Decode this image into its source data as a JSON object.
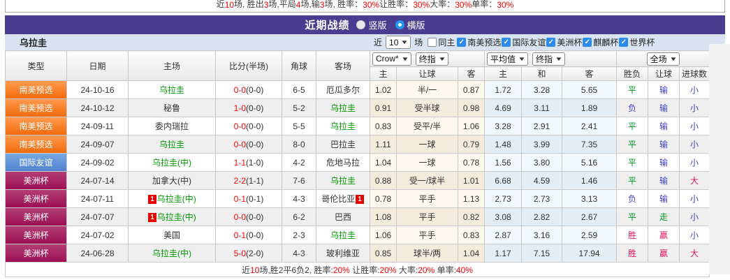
{
  "top_stats": {
    "segments": [
      {
        "t": "近 ",
        "c": "dark"
      },
      {
        "t": "10",
        "c": "red"
      },
      {
        "t": " 场, 胜出 ",
        "c": "dark"
      },
      {
        "t": "3",
        "c": "red"
      },
      {
        "t": " 场,平局 ",
        "c": "dark"
      },
      {
        "t": "4",
        "c": "red"
      },
      {
        "t": " 场,输 ",
        "c": "dark"
      },
      {
        "t": "3",
        "c": "red"
      },
      {
        "t": " 场, 胜率：",
        "c": "dark"
      },
      {
        "t": "30%",
        "c": "red"
      },
      {
        "t": " 让胜率：",
        "c": "dark"
      },
      {
        "t": "30%",
        "c": "red"
      },
      {
        "t": " 大率：",
        "c": "dark"
      },
      {
        "t": "30%",
        "c": "red"
      },
      {
        "t": " 单率：",
        "c": "dark"
      },
      {
        "t": "30%",
        "c": "red"
      }
    ]
  },
  "section": {
    "title": "近期战绩",
    "radios": [
      {
        "label": "竖版",
        "selected": false
      },
      {
        "label": "横版",
        "selected": true
      }
    ]
  },
  "filters": {
    "team": "乌拉圭",
    "near_label": "近",
    "count": "10",
    "unit": "场",
    "same_home": {
      "label": "同主",
      "checked": false
    },
    "leagues": [
      {
        "label": "南美预选",
        "checked": true
      },
      {
        "label": "国际友谊",
        "checked": true
      },
      {
        "label": "美洲杯",
        "checked": true
      },
      {
        "label": "麒麟杯",
        "checked": true
      },
      {
        "label": "世界杯",
        "checked": true
      }
    ]
  },
  "table": {
    "headers": {
      "type": "类型",
      "date": "日期",
      "home": "主场",
      "score": "比分(半场)",
      "corner": "角球",
      "away": "客场",
      "sub": [
        "主",
        "让球",
        "客",
        "主",
        "和",
        "客",
        "胜负",
        "让球",
        "进球数"
      ]
    },
    "selectors": {
      "crow": "Crow*",
      "zhong1": "终指",
      "avg": "平均值",
      "zhong2": "终指",
      "scope": "全场"
    },
    "type_class": {
      "南美预选": "orange",
      "国际友谊": "blue",
      "美洲杯": "crimson"
    },
    "result_class": {
      "平": "o-green",
      "负": "o-blue",
      "胜": "o-red",
      "输": "o-blue",
      "走": "o-green",
      "赢": "o-red",
      "小": "o-blue",
      "大": "o-red"
    },
    "rows": [
      {
        "league": "南美预选",
        "date": "24-10-16",
        "home": {
          "name": "乌拉圭",
          "focus": true
        },
        "score_ft": "0-0",
        "score_ht": "(0-0)",
        "corner": "6-5",
        "away": {
          "name": "厄瓜多尔"
        },
        "home_odds": "1.02",
        "handicap": "半/一",
        "away_odds": "0.87",
        "avg": [
          "1.72",
          "3.28",
          "5.65"
        ],
        "outcome": {
          "wdl": "平",
          "handicap": "输",
          "goals": "小"
        }
      },
      {
        "league": "南美预选",
        "date": "24-10-12",
        "home": {
          "name": "秘鲁"
        },
        "score_ft": "1-0",
        "score_ht": "(0-0)",
        "corner": "5-2",
        "away": {
          "name": "乌拉圭",
          "focus": true
        },
        "home_odds": "0.91",
        "handicap": "受半球",
        "away_odds": "0.98",
        "avg": [
          "4.69",
          "3.11",
          "1.89"
        ],
        "outcome": {
          "wdl": "负",
          "handicap": "输",
          "goals": "小"
        }
      },
      {
        "league": "南美预选",
        "date": "24-09-11",
        "home": {
          "name": "委内瑞拉"
        },
        "score_ft": "0-0",
        "score_ht": "(0-0)",
        "corner": "5-5",
        "away": {
          "name": "乌拉圭",
          "focus": true
        },
        "home_odds": "0.83",
        "handicap": "受平/半",
        "away_odds": "1.06",
        "avg": [
          "3.28",
          "2.91",
          "2.41"
        ],
        "outcome": {
          "wdl": "平",
          "handicap": "输",
          "goals": "小"
        }
      },
      {
        "league": "南美预选",
        "date": "24-09-07",
        "home": {
          "name": "乌拉圭",
          "focus": true
        },
        "score_ft": "0-0",
        "score_ht": "(0-0)",
        "corner": "8-0",
        "away": {
          "name": "巴拉圭"
        },
        "home_odds": "1.11",
        "handicap": "一球",
        "away_odds": "0.79",
        "avg": [
          "1.48",
          "3.99",
          "7.35"
        ],
        "outcome": {
          "wdl": "平",
          "handicap": "输",
          "goals": "小"
        }
      },
      {
        "league": "国际友谊",
        "date": "24-09-02",
        "home": {
          "name": "乌拉圭(中)",
          "focus": true
        },
        "score_ft": "1-1",
        "score_ht": "(1-0)",
        "corner": "4-2",
        "away": {
          "name": "危地马拉"
        },
        "home_odds": "1.04",
        "handicap": "一球",
        "away_odds": "0.78",
        "avg": [
          "1.56",
          "3.80",
          "5.16"
        ],
        "outcome": {
          "wdl": "平",
          "handicap": "输",
          "goals": "小"
        }
      },
      {
        "league": "美洲杯",
        "date": "24-07-14",
        "home": {
          "name": "加拿大(中)"
        },
        "score_ft": "2-2",
        "score_ht": "(1-1)",
        "corner": "7-6",
        "away": {
          "name": "乌拉圭",
          "focus": true
        },
        "home_odds": "0.88",
        "handicap": "受一/球半",
        "away_odds": "1.01",
        "avg": [
          "6.68",
          "4.59",
          "1.46"
        ],
        "outcome": {
          "wdl": "平",
          "handicap": "输",
          "goals": "大"
        }
      },
      {
        "league": "美洲杯",
        "date": "24-07-11",
        "home": {
          "name": "乌拉圭(中)",
          "focus": true,
          "red_card": "1"
        },
        "score_ft": "0-1",
        "score_ht": "(0-1)",
        "corner": "4-3",
        "away": {
          "name": "哥伦比亚",
          "red_card": "1"
        },
        "home_odds": "0.78",
        "handicap": "平手",
        "away_odds": "1.13",
        "avg": [
          "2.73",
          "2.73",
          "3.13"
        ],
        "outcome": {
          "wdl": "负",
          "handicap": "输",
          "goals": "小"
        }
      },
      {
        "league": "美洲杯",
        "date": "24-07-07",
        "home": {
          "name": "乌拉圭(中)",
          "focus": true,
          "red_card": "1"
        },
        "score_ft": "0-0",
        "score_ht": "(0-0)",
        "corner": "6-2",
        "away": {
          "name": "巴西"
        },
        "home_odds": "1.08",
        "handicap": "平手",
        "away_odds": "0.82",
        "avg": [
          "3.08",
          "2.82",
          "2.67"
        ],
        "outcome": {
          "wdl": "平",
          "handicap": "走",
          "goals": "小"
        }
      },
      {
        "league": "美洲杯",
        "date": "24-07-02",
        "home": {
          "name": "美国"
        },
        "score_ft": "0-1",
        "score_ht": "(0-0)",
        "corner": "2-3",
        "away": {
          "name": "乌拉圭",
          "focus": true
        },
        "home_odds": "1.06",
        "handicap": "平手",
        "away_odds": "0.83",
        "avg": [
          "2.87",
          "3.16",
          "2.59"
        ],
        "outcome": {
          "wdl": "胜",
          "handicap": "赢",
          "goals": "小"
        }
      },
      {
        "league": "美洲杯",
        "date": "24-06-28",
        "home": {
          "name": "乌拉圭(中)",
          "focus": true
        },
        "score_ft": "5-0",
        "score_ht": "(2-0)",
        "corner": "4-3",
        "away": {
          "name": "玻利维亚"
        },
        "home_odds": "0.85",
        "handicap": "球半/两",
        "away_odds": "1.04",
        "avg": [
          "1.17",
          "7.15",
          "17.94"
        ],
        "outcome": {
          "wdl": "胜",
          "handicap": "赢",
          "goals": "大"
        }
      }
    ]
  },
  "bottom_stats": {
    "segments": [
      {
        "t": "近",
        "c": "dark"
      },
      {
        "t": "10",
        "c": "red"
      },
      {
        "t": "场,胜2平6负2, 胜率:",
        "c": "dark"
      },
      {
        "t": "20%",
        "c": "red"
      },
      {
        "t": " 让胜率:",
        "c": "dark"
      },
      {
        "t": "20%",
        "c": "red"
      },
      {
        "t": " 大率:",
        "c": "dark"
      },
      {
        "t": "20%",
        "c": "red"
      },
      {
        "t": " 单率:",
        "c": "dark"
      },
      {
        "t": "40%",
        "c": "red"
      }
    ]
  },
  "colors": {
    "accent_purple": "#4a3d8f",
    "filter_bg": "#d9e3f1",
    "type_orange": "#f26a0a",
    "type_blue": "#5a8bd8",
    "type_crimson": "#9c1053",
    "focus_team_green": "#009900",
    "score_red": "#ff0000",
    "result_red": "#e01555",
    "result_blue": "#4040cc",
    "result_green": "#009426",
    "checkbox_blue": "#2b8ced"
  }
}
